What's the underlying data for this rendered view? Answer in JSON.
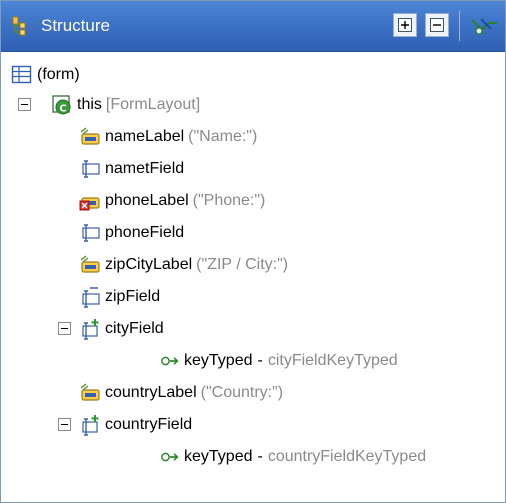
{
  "panel": {
    "title": "Structure"
  },
  "toolbar": {
    "expand_all": "expand-all",
    "collapse_all": "collapse-all",
    "filter": "filter"
  },
  "tree": {
    "form": "(form)",
    "root": {
      "name": "this",
      "extra": "[FormLayout]"
    },
    "items": [
      {
        "name": "nameLabel",
        "extra": "(\"Name:\")"
      },
      {
        "name": "nametField",
        "extra": ""
      },
      {
        "name": "phoneLabel",
        "extra": "(\"Phone:\")"
      },
      {
        "name": "phoneField",
        "extra": ""
      },
      {
        "name": "zipCityLabel",
        "extra": "(\"ZIP / City:\")"
      },
      {
        "name": "zipField",
        "extra": ""
      },
      {
        "name": "cityField",
        "extra": ""
      },
      {
        "name": "keyTyped",
        "extra": "cityFieldKeyTyped"
      },
      {
        "name": "countryLabel",
        "extra": "(\"Country:\")"
      },
      {
        "name": "countryField",
        "extra": ""
      },
      {
        "name": "keyTyped",
        "extra": "countryFieldKeyTyped"
      }
    ]
  },
  "colors": {
    "titlebar": "#3e73c6",
    "border": "#7f9db9",
    "secondary_text": "#8a8a8a"
  }
}
